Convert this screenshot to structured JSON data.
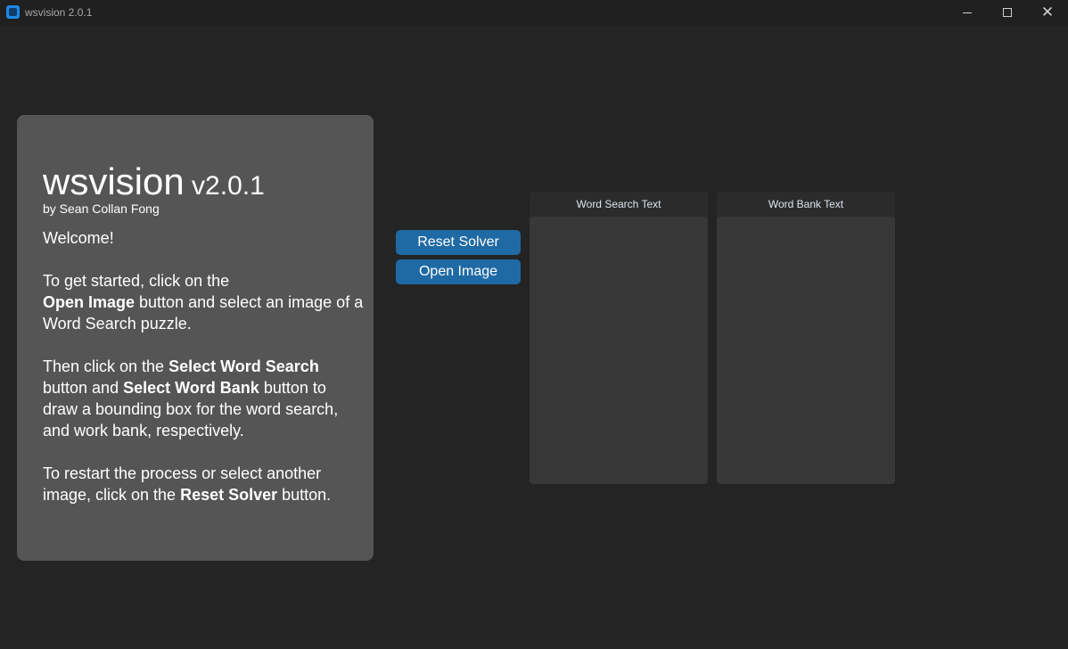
{
  "window": {
    "title": "wsvision 2.0.1",
    "icon": "app-icon",
    "controls": {
      "minimize": "minimize-icon",
      "maximize": "maximize-icon",
      "close": "✕"
    }
  },
  "info": {
    "app_name": "wsvision",
    "version": " v2.0.1",
    "author": "by Sean Collan Fong",
    "welcome": "Welcome!",
    "para1": {
      "pre": "To get started, click on the",
      "bold": "Open Image",
      "post": " button and select an image of a Word Search puzzle."
    },
    "para2": {
      "pre": "Then click on the ",
      "bold1": "Select Word Search",
      "mid": " button and ",
      "bold2": "Select Word Bank",
      "post": " button to draw a bounding box for the word search, and work bank, respectively."
    },
    "para3": {
      "pre": "To restart the process or select another image, click on the ",
      "bold": "Reset Solver",
      "post": " button."
    }
  },
  "buttons": {
    "reset_label": "Reset Solver",
    "open_label": "Open Image"
  },
  "panels": {
    "word_search": {
      "label": "Word Search Text",
      "value": ""
    },
    "word_bank": {
      "label": "Word Bank Text",
      "value": ""
    }
  },
  "colors": {
    "background": "#242424",
    "panel": "#555555",
    "accent": "#1f6aa5",
    "textbox": "#383838"
  }
}
